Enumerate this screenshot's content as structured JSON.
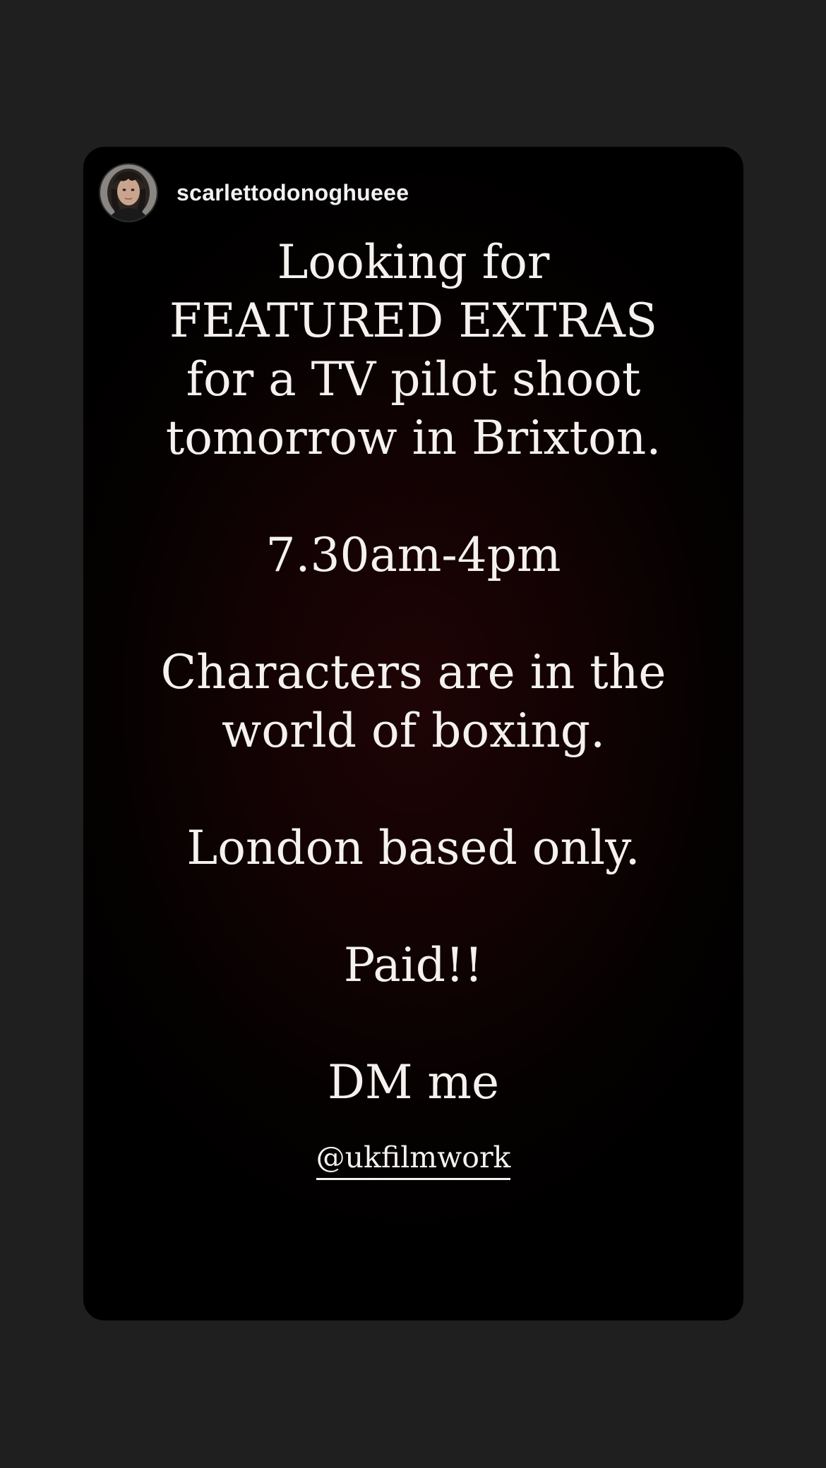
{
  "story": {
    "author": {
      "username": "scarlettodonoghueee",
      "avatar_icon": "profile-photo"
    },
    "lines": {
      "l1": "Looking for",
      "l2": "FEATURED EXTRAS",
      "l3": "for a TV pilot shoot",
      "l4": "tomorrow in Brixton.",
      "l5": "7.30am-4pm",
      "l6": "Characters are in the",
      "l7": "world of boxing.",
      "l8": "London based only.",
      "l9": "Paid!!",
      "l10": "DM me"
    },
    "mention": "@ukfilmwork"
  },
  "colors": {
    "page_background": "#1f1f1f",
    "card_background": "#000000",
    "card_glow": "#1f0405",
    "text": "#f4f1ee"
  }
}
